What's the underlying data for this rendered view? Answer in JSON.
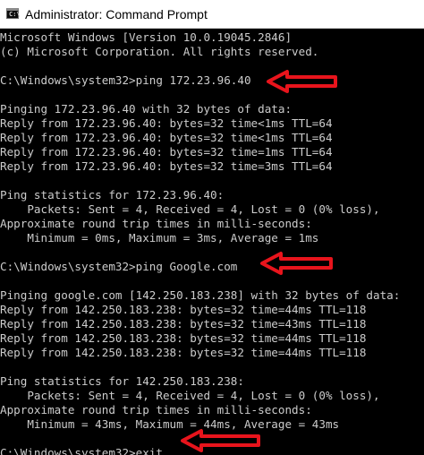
{
  "window": {
    "title": "Administrator: Command Prompt",
    "icon": "cmd-icon",
    "icon_text": "C:\\"
  },
  "console": {
    "background": "#000000",
    "text_color": "#cccccc",
    "lines": [
      "Microsoft Windows [Version 10.0.19045.2846]",
      "(c) Microsoft Corporation. All rights reserved.",
      "",
      "C:\\Windows\\system32>ping 172.23.96.40",
      "",
      "Pinging 172.23.96.40 with 32 bytes of data:",
      "Reply from 172.23.96.40: bytes=32 time<1ms TTL=64",
      "Reply from 172.23.96.40: bytes=32 time<1ms TTL=64",
      "Reply from 172.23.96.40: bytes=32 time=1ms TTL=64",
      "Reply from 172.23.96.40: bytes=32 time=3ms TTL=64",
      "",
      "Ping statistics for 172.23.96.40:",
      "    Packets: Sent = 4, Received = 4, Lost = 0 (0% loss),",
      "Approximate round trip times in milli-seconds:",
      "    Minimum = 0ms, Maximum = 3ms, Average = 1ms",
      "",
      "C:\\Windows\\system32>ping Google.com",
      "",
      "Pinging google.com [142.250.183.238] with 32 bytes of data:",
      "Reply from 142.250.183.238: bytes=32 time=44ms TTL=118",
      "Reply from 142.250.183.238: bytes=32 time=43ms TTL=118",
      "Reply from 142.250.183.238: bytes=32 time=44ms TTL=118",
      "Reply from 142.250.183.238: bytes=32 time=44ms TTL=118",
      "",
      "Ping statistics for 142.250.183.238:",
      "    Packets: Sent = 4, Received = 4, Lost = 0 (0% loss),",
      "Approximate round trip times in milli-seconds:",
      "    Minimum = 43ms, Maximum = 44ms, Average = 43ms",
      "",
      "C:\\Windows\\system32>exit"
    ]
  },
  "annotations": {
    "arrow_color": "#e8141c",
    "arrows": [
      "left-arrow-icon",
      "left-arrow-icon",
      "left-arrow-icon"
    ]
  }
}
